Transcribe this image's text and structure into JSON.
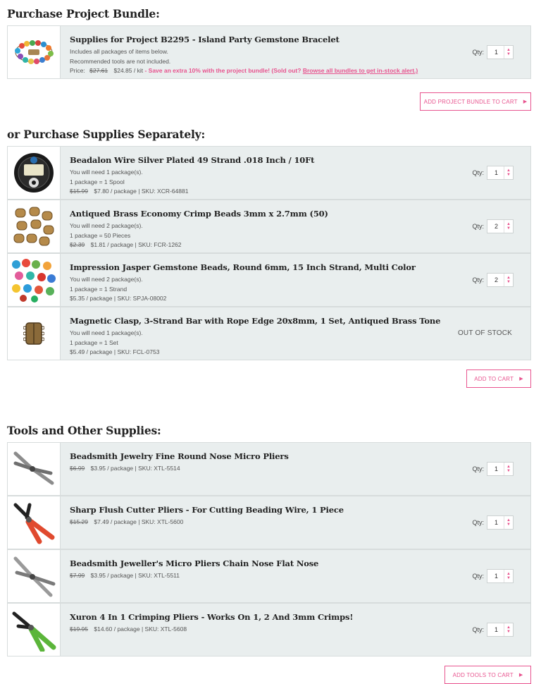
{
  "colors": {
    "accent": "#e8548f",
    "row_bg": "#e9eeee",
    "border": "#d7dcdc"
  },
  "qty_label": "Qty:",
  "bundle": {
    "title": "Purchase Project Bundle:",
    "item": {
      "name": "Supplies for Project B2295 - Island Party Gemstone Bracelet",
      "line1": "Includes all packages of items below.",
      "line2": "Recommended tools are not included.",
      "price_label": "Price:",
      "old_price": "$27.61",
      "price": "$24.85 / kit",
      "promo": "- Save an extra 10% with the project bundle! (Sold out?",
      "promo_link": "Browse all bundles to get in-stock alert.)",
      "qty": "1",
      "icon": "bracelet-thumbnail"
    },
    "button": "Add Project Bundle To Cart"
  },
  "separately": {
    "title": "or Purchase Supplies Separately:",
    "items": [
      {
        "name": "Beadalon Wire Silver Plated 49 Strand .018 Inch / 10Ft",
        "need": "You will need 1 package(s).",
        "pkg": "1 package = 1 Spool",
        "old_price": "$15.99",
        "price": "$7.80 / package",
        "sku": "| SKU: XCR-64881",
        "qty": "1",
        "icon": "wire-spool-thumbnail"
      },
      {
        "name": "Antiqued Brass Economy Crimp Beads 3mm x 2.7mm (50)",
        "need": "You will need 2 package(s).",
        "pkg": "1 package = 50 Pieces",
        "old_price": "$2.39",
        "price": "$1.81 / package",
        "sku": "| SKU: FCR-1262",
        "qty": "2",
        "icon": "crimp-beads-thumbnail"
      },
      {
        "name": "Impression Jasper Gemstone Beads, Round 6mm, 15 Inch Strand, Multi Color",
        "need": "You will need 2 package(s).",
        "pkg": "1 package = 1 Strand",
        "old_price": "",
        "price": "$5.35 / package",
        "sku": "| SKU: SPJA-08002",
        "qty": "2",
        "icon": "gemstone-beads-thumbnail"
      },
      {
        "name": "Magnetic Clasp, 3-Strand Bar with Rope Edge 20x8mm, 1 Set, Antiqued Brass Tone",
        "need": "You will need 1 package(s).",
        "pkg": "1 package = 1 Set",
        "old_price": "",
        "price": "$5.49 / package",
        "sku": "| SKU: FCL-0753",
        "status": "OUT OF STOCK",
        "icon": "magnetic-clasp-thumbnail"
      }
    ],
    "button": "Add To Cart"
  },
  "tools": {
    "title": "Tools and Other Supplies:",
    "items": [
      {
        "name": "Beadsmith Jewelry Fine Round Nose Micro Pliers",
        "old_price": "$6.99",
        "price": "$3.95 / package",
        "sku": "| SKU: XTL-5514",
        "qty": "1",
        "icon": "round-nose-pliers-thumbnail"
      },
      {
        "name": "Sharp Flush Cutter Pliers - For Cutting Beading Wire, 1 Piece",
        "old_price": "$15.29",
        "price": "$7.49 / package",
        "sku": "| SKU: XTL-5600",
        "qty": "1",
        "icon": "flush-cutter-thumbnail"
      },
      {
        "name": "Beadsmith Jeweller's Micro Pliers Chain Nose Flat Nose",
        "old_price": "$7.99",
        "price": "$3.95 / package",
        "sku": "| SKU: XTL-5511",
        "qty": "1",
        "icon": "chain-nose-pliers-thumbnail"
      },
      {
        "name": "Xuron 4 In 1 Crimping Pliers - Works On 1, 2 And 3mm Crimps!",
        "old_price": "$19.95",
        "price": "$14.60 / package",
        "sku": "| SKU: XTL-5608",
        "qty": "1",
        "icon": "crimping-pliers-thumbnail"
      }
    ],
    "button": "Add Tools To Cart"
  }
}
